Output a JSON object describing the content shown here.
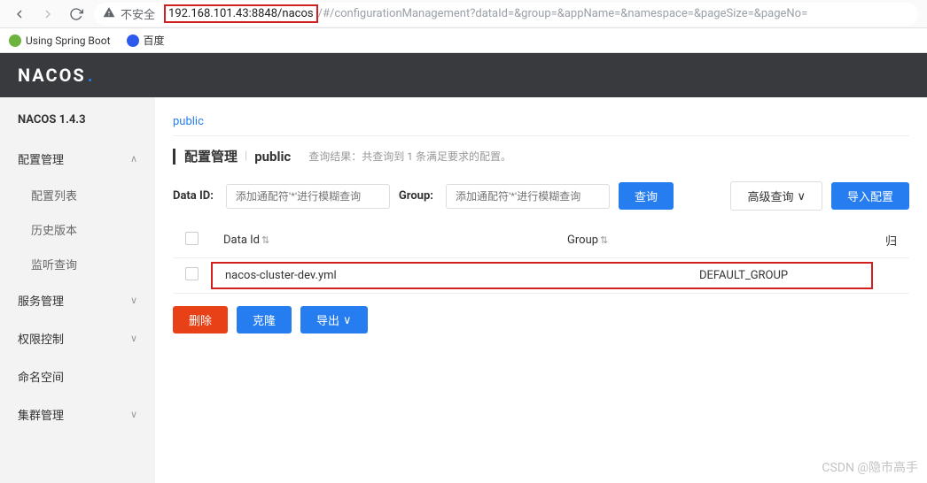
{
  "browser": {
    "security_label": "不安全",
    "url_highlight": "192.168.101.43:8848/nacos",
    "url_rest": "/#/configurationManagement?dataId=&group=&appName=&namespace=&pageSize=&pageNo="
  },
  "bookmarks": {
    "spring": "Using Spring Boot",
    "baidu": "百度"
  },
  "brand": "NACOS",
  "sidebar": {
    "title": "NACOS 1.4.3",
    "menu": {
      "config": "配置管理",
      "config_list": "配置列表",
      "history": "历史版本",
      "listen": "监听查询",
      "service": "服务管理",
      "auth": "权限控制",
      "namespace": "命名空间",
      "cluster": "集群管理"
    }
  },
  "content": {
    "namespace": "public",
    "page_title": "配置管理",
    "page_ns": "public",
    "query_prefix": "查询结果：共查询到",
    "query_count": "1",
    "query_suffix": "条满足要求的配置。",
    "data_id_label": "Data ID:",
    "data_id_placeholder": "添加通配符'*'进行模糊查询",
    "group_label": "Group:",
    "group_placeholder": "添加通配符'*'进行模糊查询",
    "btn_query": "查询",
    "btn_advanced": "高级查询",
    "btn_import": "导入配置",
    "col_dataid": "Data Id",
    "col_group": "Group",
    "col_owner": "归",
    "row": {
      "dataid": "nacos-cluster-dev.yml",
      "group": "DEFAULT_GROUP"
    },
    "btn_delete": "删除",
    "btn_clone": "克隆",
    "btn_export": "导出"
  },
  "watermark": "CSDN @隐市高手"
}
